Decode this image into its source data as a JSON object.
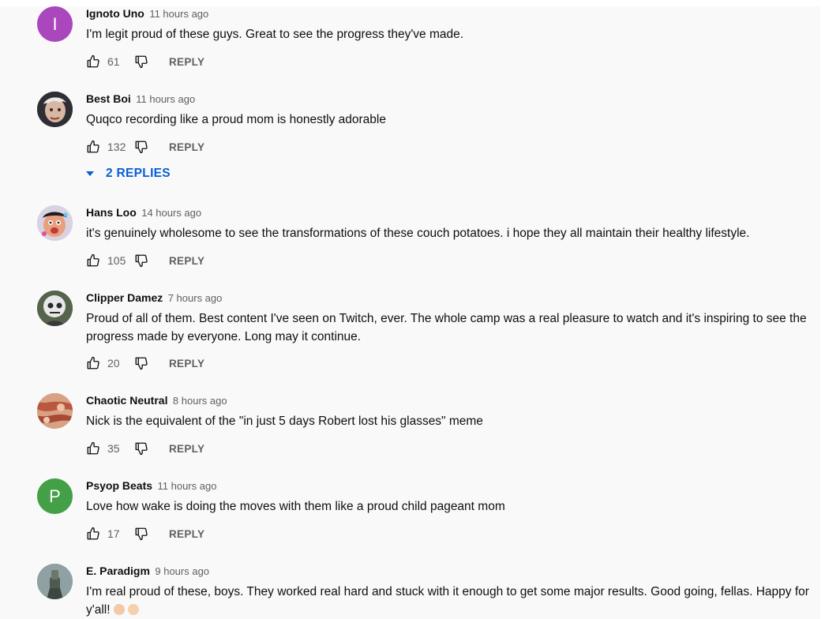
{
  "comments": [
    {
      "author": "Ignoto Uno",
      "time": "11 hours ago",
      "text": "I'm legit proud of these guys. Great to see the progress they've made.",
      "likes": "61",
      "reply_label": "REPLY",
      "avatar": {
        "letter": "I",
        "color": "#ab47bc"
      }
    },
    {
      "author": "Best Boi",
      "time": "11 hours ago",
      "text": "Quqco recording like a proud mom is honestly adorable",
      "likes": "132",
      "reply_label": "REPLY",
      "replies_label": "2 REPLIES"
    },
    {
      "author": "Hans Loo",
      "time": "14 hours ago",
      "text": "it's genuinely wholesome to see the transformations of these couch potatoes. i hope they all maintain their healthy lifestyle.",
      "likes": "105",
      "reply_label": "REPLY"
    },
    {
      "author": "Clipper Damez",
      "time": "7 hours ago",
      "text": "Proud of all of them. Best content I've seen on Twitch, ever. The whole camp was a real pleasure to watch and it's inspiring to see the progress made by everyone. Long may it continue.",
      "likes": "20",
      "reply_label": "REPLY"
    },
    {
      "author": "Chaotic Neutral",
      "time": "8 hours ago",
      "text": "Nick is the equivalent of the \"in just 5 days Robert lost his glasses\" meme",
      "likes": "35",
      "reply_label": "REPLY"
    },
    {
      "author": "Psyop Beats",
      "time": "11 hours ago",
      "text": "Love how wake is doing the moves with them like a proud child pageant mom",
      "likes": "17",
      "reply_label": "REPLY",
      "avatar": {
        "letter": "P",
        "color": "#43a047"
      }
    },
    {
      "author": "E. Paradigm",
      "time": "9 hours ago",
      "text": "I'm real proud of these, boys. They worked real hard and stuck with it enough to get some major results. Good going, fellas. Happy for y'all!",
      "emoji_icons": [
        "flexed-biceps-icon",
        "ok-hand-icon"
      ]
    }
  ],
  "colors": {
    "link_blue": "#065fd4",
    "secondary_text": "#606060",
    "primary_text": "#0f0f0f",
    "background": "#f9f9f9"
  }
}
